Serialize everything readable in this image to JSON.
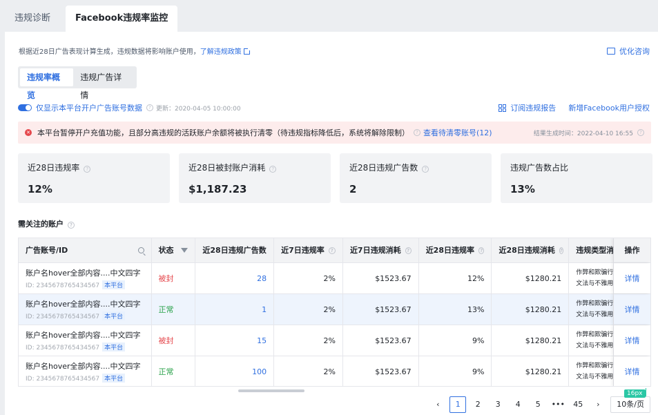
{
  "tabs": [
    {
      "label": "违规诊断"
    },
    {
      "label": "Facebook违规率监控"
    }
  ],
  "note": {
    "text": "根据近28日广告表现计算生成，违规数据将影响账户使用，",
    "link": "了解违规政策"
  },
  "consult": {
    "label": "优化咨询"
  },
  "subtabs": [
    {
      "label": "违规率概览"
    },
    {
      "label": "违规广告详情"
    }
  ],
  "filter": {
    "label": "仅显示本平台开户广告账号数据",
    "updated": "更新：2020-04-05 10:00:00"
  },
  "actions": {
    "subscribe": "订阅违规报告",
    "add_auth": "新增Facebook用户授权"
  },
  "alert": {
    "text": "本平台暂停开户充值功能，且部分高违规的活跃账户余额将被执行清零（待违规指标降低后，系统将解除限制）",
    "link": "查看待清零账号(12)",
    "time": "结果生成时间：2022-04-10 16:55"
  },
  "stats": [
    {
      "label": "近28日违规率",
      "value": "12%"
    },
    {
      "label": "近28日被封账户消耗",
      "value": "$1,187.23"
    },
    {
      "label": "近28日违规广告数",
      "value": "2"
    },
    {
      "label": "违规广告数占比",
      "value": "13%"
    }
  ],
  "section": {
    "title": "需关注的账户"
  },
  "table": {
    "headers": [
      "广告账号/ID",
      "状态",
      "近28日违规广告数",
      "近7日违规率",
      "近7日违规消耗",
      "近28日违规率",
      "近28日违规消耗",
      "违规类型消耗",
      "操作"
    ],
    "rows": [
      {
        "name": "账户名hover全部内容....中文四字",
        "id": "ID: 2345678765434567",
        "tag": "本平台",
        "status": "被封",
        "ads": "28",
        "rate7": "2%",
        "cost7": "$1523.67",
        "rate28": "12%",
        "cost28": "$1280.21",
        "type1": "作弊和欺骗行为",
        "type2": "文法与不雅用语",
        "action": "详情"
      },
      {
        "name": "账户名hover全部内容....中文四字",
        "id": "ID: 2345678765434567",
        "tag": "本平台",
        "status": "正常",
        "ads": "1",
        "rate7": "2%",
        "cost7": "$1523.67",
        "rate28": "13%",
        "cost28": "$1280.21",
        "type1": "作弊和欺骗行为",
        "type2": "文法与不雅用语",
        "action": "详情"
      },
      {
        "name": "账户名hover全部内容....中文四字",
        "id": "ID: 2345678765434567",
        "tag": "本平台",
        "status": "被封",
        "ads": "15",
        "rate7": "2%",
        "cost7": "$1523.67",
        "rate28": "9%",
        "cost28": "$1280.21",
        "type1": "作弊和欺骗行为",
        "type2": "文法与不雅用语",
        "action": "详情"
      },
      {
        "name": "账户名hover全部内容....中文四字",
        "id": "ID: 2345678765434567",
        "tag": "本平台",
        "status": "正常",
        "ads": "100",
        "rate7": "2%",
        "cost7": "$1523.67",
        "rate28": "9%",
        "cost28": "$1280.21",
        "type1": "作弊和欺骗行为",
        "type2": "文法与不雅用语",
        "action": "详情"
      }
    ]
  },
  "pagination": {
    "prev": "‹",
    "pages": [
      "1",
      "2",
      "3",
      "4",
      "5",
      "•••",
      "45"
    ],
    "next": "›",
    "page_size": "10条/页",
    "current_page": 1
  },
  "measure": {
    "label": "16px"
  },
  "colors": {
    "accent": "#2f6fe0",
    "danger": "#e5484d",
    "success": "#2aa24a",
    "alert_bg": "#fdecec"
  }
}
